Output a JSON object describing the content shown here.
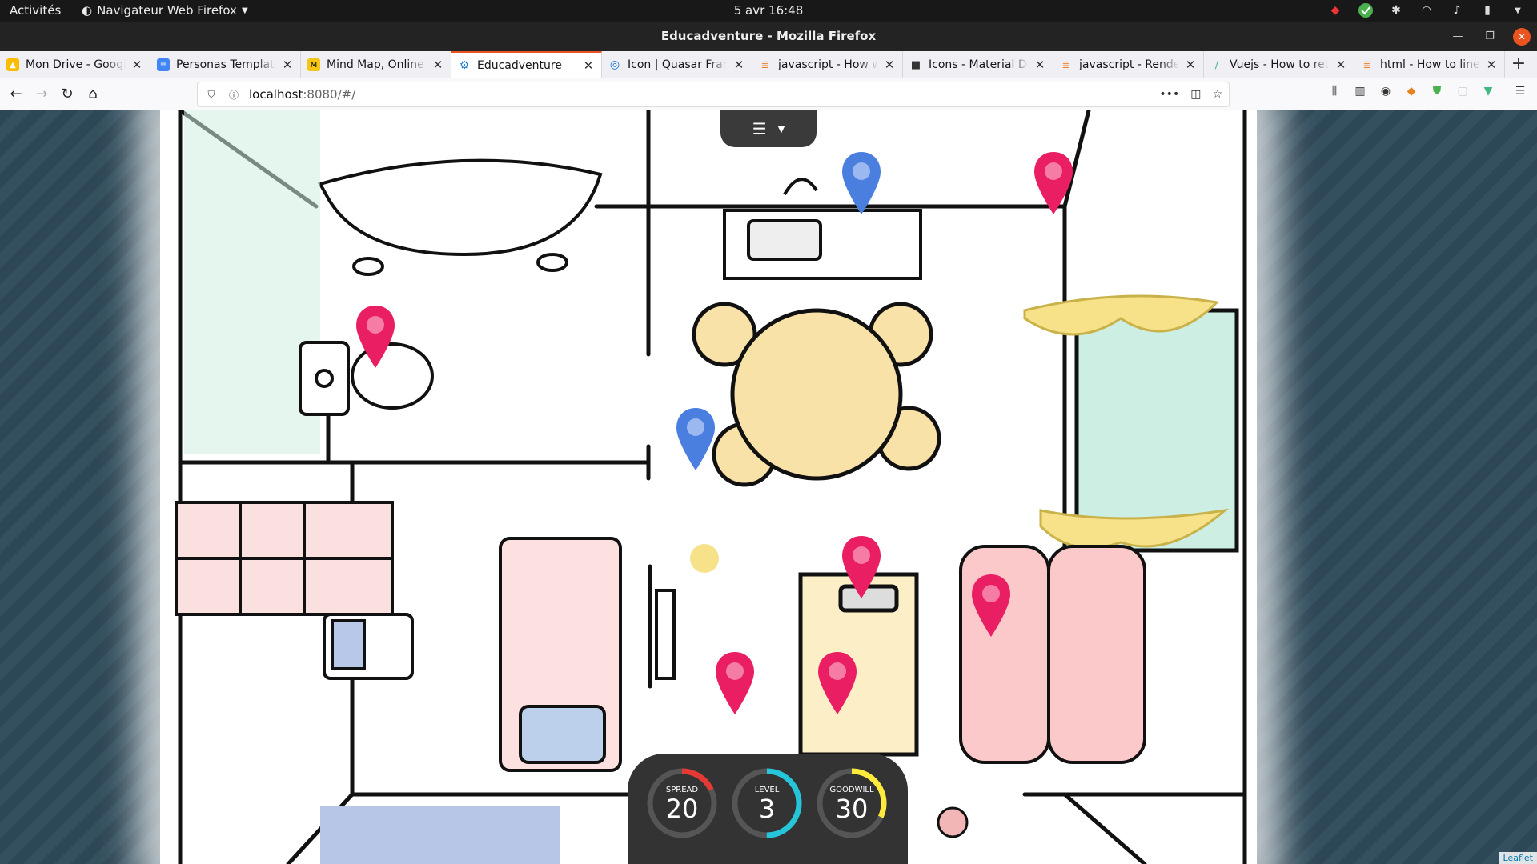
{
  "topbar": {
    "activities": "Activités",
    "app_menu": "Navigateur Web Firefox",
    "clock": "5 avr  16:48"
  },
  "window": {
    "title": "Educadventure - Mozilla Firefox"
  },
  "tabs": [
    {
      "label": "Mon Drive - Google",
      "color": "#fbbc04"
    },
    {
      "label": "Personas Template",
      "color": "#4285f4"
    },
    {
      "label": "Mind Map, Online",
      "color": "#f5c518"
    },
    {
      "label": "Educadventure",
      "color": "#1976d2",
      "active": true
    },
    {
      "label": "Icon | Quasar Fram",
      "color": "#1976d2"
    },
    {
      "label": "javascript - How wo",
      "color": "#f48024"
    },
    {
      "label": "Icons - Material De",
      "color": "#333333"
    },
    {
      "label": "javascript - Render",
      "color": "#f48024"
    },
    {
      "label": "Vuejs - How to retu",
      "color": "#42b883"
    },
    {
      "label": "html - How to line-t",
      "color": "#f48024"
    }
  ],
  "navbar": {
    "url_host": "localhost",
    "url_rest": ":8080/#/"
  },
  "map": {
    "attribution": "Leaflet",
    "pin_colors": {
      "magenta": "#e91e63",
      "blue": "#4a7fe0"
    }
  },
  "stats": [
    {
      "label": "SPREAD",
      "value": "20",
      "fraction": 0.18,
      "color": "#e53935"
    },
    {
      "label": "LEVEL",
      "value": "3",
      "fraction": 0.5,
      "color": "#26c6da"
    },
    {
      "label": "GOODWILL",
      "value": "30",
      "fraction": 0.32,
      "color": "#ffeb3b"
    }
  ]
}
